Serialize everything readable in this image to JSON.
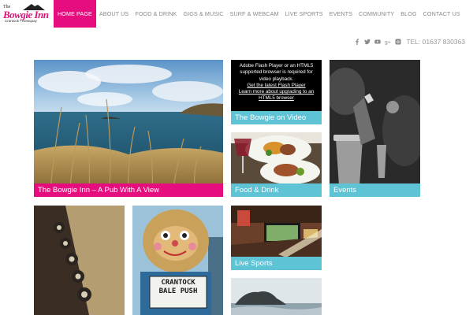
{
  "logo": {
    "the": "The",
    "name": "Bowgie Inn",
    "sub": "Crantock • Newquay"
  },
  "nav": [
    {
      "label": "HOME PAGE",
      "active": true
    },
    {
      "label": "ABOUT US"
    },
    {
      "label": "FOOD & DRINK"
    },
    {
      "label": "GIGS & MUSIC"
    },
    {
      "label": "SURF & WEBCAM"
    },
    {
      "label": "LIVE SPORTS"
    },
    {
      "label": "EVENTS"
    },
    {
      "label": "COMMUNITY"
    },
    {
      "label": "BLOG"
    },
    {
      "label": "CONTACT US"
    }
  ],
  "social": {
    "icons": [
      "facebook-icon",
      "twitter-icon",
      "youtube-icon",
      "google-plus-icon",
      "instagram-icon"
    ],
    "tel": "TEL: 01637 830363"
  },
  "tiles": {
    "pub_view": {
      "caption": "The Bowgie Inn – A Pub With A View"
    },
    "video": {
      "caption": "The Bowgie on Video",
      "flash_text": "Adobe Flash Player or an HTML5 supported browser is required for video playback.",
      "flash_link1": "Get the latest Flash Player",
      "flash_link2": "Learn more about upgrading to an HTML5 browser"
    },
    "events": {
      "caption": "Events"
    },
    "food": {
      "caption": "Food & Drink"
    },
    "sports": {
      "caption": "Live Sports"
    },
    "bale_sign": "CRANTOCK BALE PUSH"
  },
  "colors": {
    "accent_pink": "#e60e7e",
    "caption_blue": "#5ec3d5"
  }
}
